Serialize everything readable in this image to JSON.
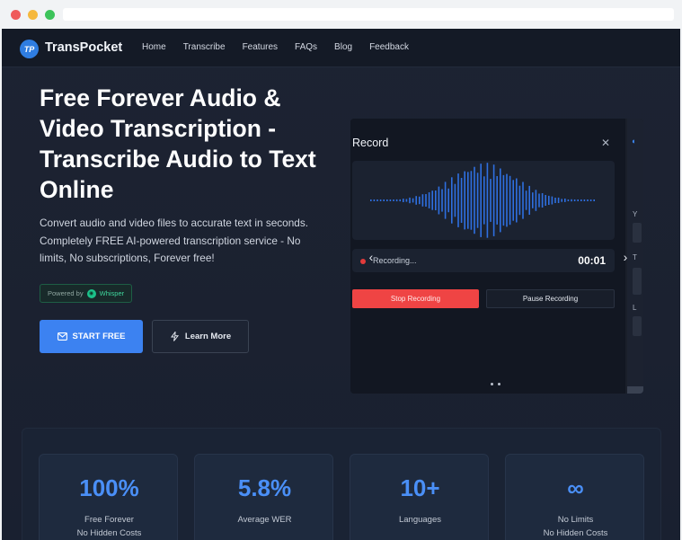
{
  "brand": {
    "logo_initials": "TP",
    "name": "TransPocket"
  },
  "nav": {
    "items": [
      "Home",
      "Transcribe",
      "Features",
      "FAQs",
      "Blog",
      "Feedback"
    ]
  },
  "hero": {
    "title": "Free Forever Audio & Video Transcription - Transcribe Audio to Text Online",
    "subtitle": "Convert audio and video files to accurate text in seconds. Completely FREE AI-powered transcription service - No limits, No subscriptions, Forever free!",
    "powered_by": "Powered by",
    "powered_name": "Whisper",
    "start_label": "START FREE",
    "learn_label": "Learn More"
  },
  "recorder": {
    "title": "Record",
    "status": "Recording...",
    "time": "00:01",
    "stop_label": "Stop Recording",
    "pause_label": "Pause Recording",
    "side_labels": [
      "Y",
      "T",
      "L"
    ]
  },
  "stats": [
    {
      "value": "100%",
      "label": "Free Forever",
      "sub": "No Hidden Costs"
    },
    {
      "value": "5.8%",
      "label": "Average WER",
      "sub": ""
    },
    {
      "value": "10+",
      "label": "Languages",
      "sub": ""
    },
    {
      "value": "∞",
      "label": "No Limits",
      "sub": "No Hidden Costs"
    }
  ],
  "colors": {
    "accent": "#3c82f1",
    "stop": "#ef4444",
    "wave": "#2f6fe0",
    "whisper": "#1cc28a"
  },
  "icons": [
    "close-icon",
    "mail-icon",
    "sparkle-icon",
    "chevron-left-icon",
    "chevron-right-icon",
    "recording-dot-icon"
  ]
}
